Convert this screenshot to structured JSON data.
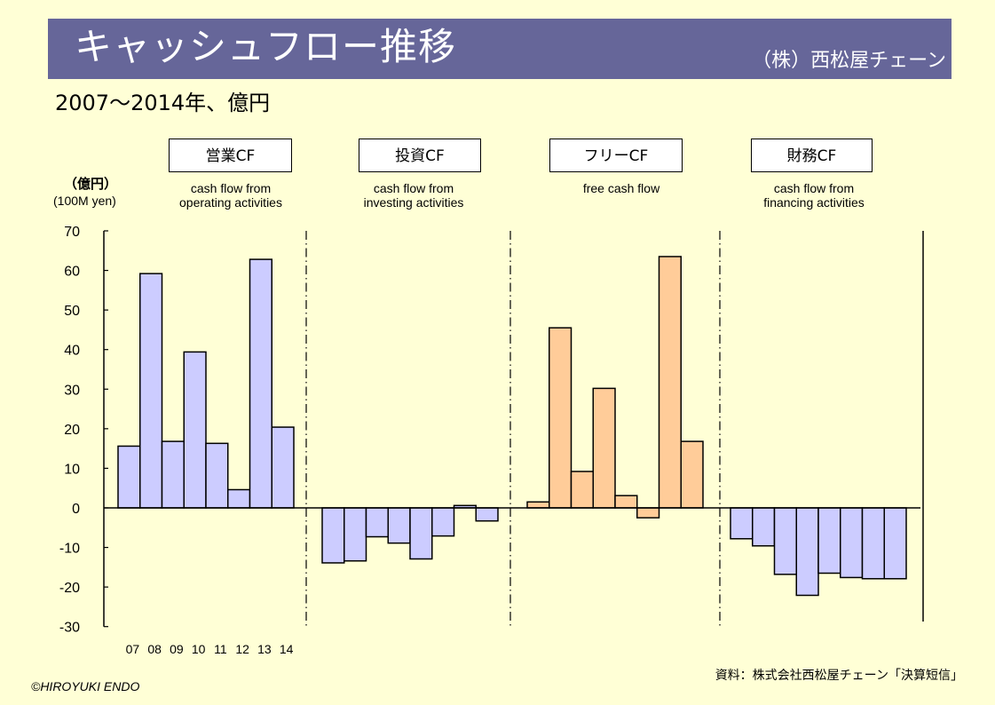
{
  "header": {
    "title": "キャッシュフロー推移",
    "company": "（株）西松屋チェーン"
  },
  "subtitle": "2007～2014年、億円",
  "unit": {
    "ja": "（億円）",
    "en": "(100M yen)"
  },
  "footer": {
    "copyright": "©HIROYUKI  ENDO",
    "source": "資料：株式会社西松屋チェーン「決算短信」"
  },
  "colors": {
    "background": "#ffffd6",
    "title_bar": "#666699",
    "bar_blue": "#ccccff",
    "bar_orange": "#ffcc99"
  },
  "chart_data": {
    "type": "bar",
    "title": "キャッシュフロー推移",
    "ylabel": "億円 (100M yen)",
    "xlabel": "",
    "ylim": [
      -30,
      70
    ],
    "yticks": [
      70,
      60,
      50,
      40,
      30,
      20,
      10,
      0,
      -10,
      -20,
      -30
    ],
    "grid": false,
    "categories": [
      "07",
      "08",
      "09",
      "10",
      "11",
      "12",
      "13",
      "14"
    ],
    "series": [
      {
        "name": "営業CF",
        "description": "cash flow from\noperating activities",
        "color": "#ccccff",
        "values": [
          15.6,
          59.2,
          16.8,
          39.4,
          16.3,
          4.6,
          62.8,
          20.4
        ]
      },
      {
        "name": "投資CF",
        "description": "cash flow from\ninvesting activities",
        "color": "#ccccff",
        "values": [
          -13.9,
          -13.4,
          -7.3,
          -8.9,
          -12.9,
          -7.1,
          0.6,
          -3.3
        ]
      },
      {
        "name": "フリーCF",
        "description": "free cash flow",
        "color": "#ffcc99",
        "values": [
          1.5,
          45.5,
          9.2,
          30.2,
          3.1,
          -2.5,
          63.5,
          16.8
        ]
      },
      {
        "name": "財務CF",
        "description": "cash flow from\nfinancing activities",
        "color": "#ccccff",
        "values": [
          -7.8,
          -9.6,
          -16.8,
          -22.1,
          -16.5,
          -17.6,
          -17.9,
          -17.9
        ]
      }
    ]
  }
}
